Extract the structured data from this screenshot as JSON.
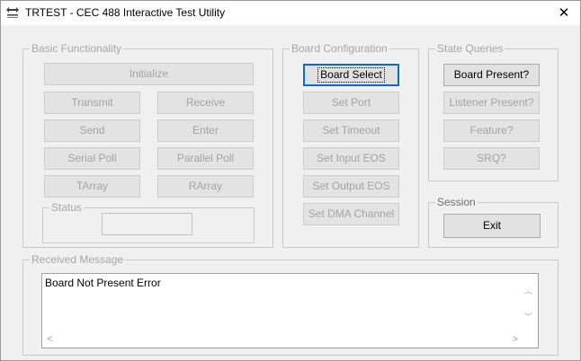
{
  "window": {
    "title": "TRTEST - CEC 488 Interactive Test Utility",
    "close_glyph": "✕"
  },
  "basic": {
    "label": "Basic Functionality",
    "initialize": "Initialize",
    "transmit": "Transmit",
    "receive": "Receive",
    "send": "Send",
    "enter": "Enter",
    "serial_poll": "Serial Poll",
    "parallel_poll": "Parallel Poll",
    "tarray": "TArray",
    "rarray": "RArray",
    "status_label": "Status"
  },
  "board_config": {
    "label": "Board Configuration",
    "board_select": "Board Select",
    "set_port": "Set Port",
    "set_timeout": "Set Timeout",
    "set_input_eos": "Set Input EOS",
    "set_output_eos": "Set Output EOS",
    "set_dma_channel": "Set DMA Channel"
  },
  "state_queries": {
    "label": "State Queries",
    "board_present": "Board Present?",
    "listener_present": "Listener Present?",
    "feature": "Feature?",
    "srq": "SRQ?"
  },
  "session": {
    "label": "Session",
    "exit": "Exit"
  },
  "received": {
    "label": "Received Message",
    "text": "Board Not Present Error",
    "up_glyph": "︿",
    "down_glyph": "﹀",
    "left_glyph": "<",
    "right_glyph": ">"
  }
}
